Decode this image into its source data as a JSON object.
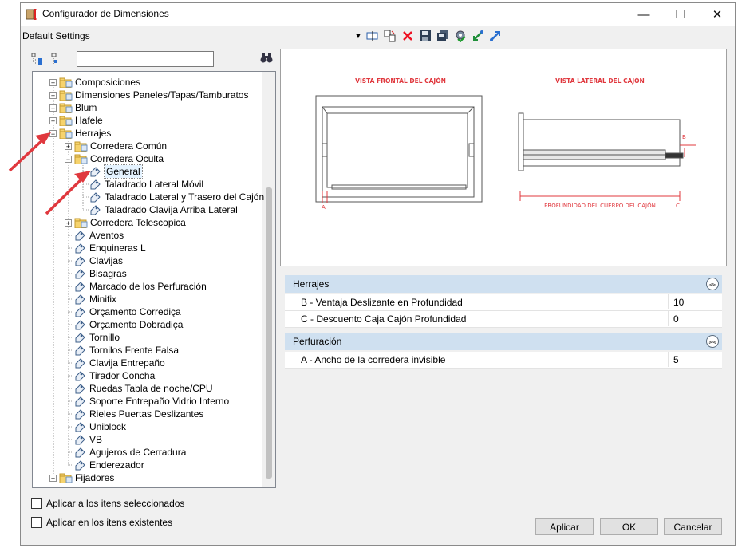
{
  "window": {
    "title": "Configurador de Dimensiones",
    "minimize": "—",
    "maximize": "☐",
    "close": "✕"
  },
  "settings": {
    "label": "Default Settings"
  },
  "tree": {
    "items": [
      {
        "label": "Composiciones"
      },
      {
        "label": "Dimensiones Paneles/Tapas/Tamburatos"
      },
      {
        "label": "Blum"
      },
      {
        "label": "Hafele"
      },
      {
        "label": "Herrajes"
      },
      {
        "label": "Corredera Común"
      },
      {
        "label": "Corredera Oculta"
      },
      {
        "label": "General"
      },
      {
        "label": "Taladrado Lateral Móvil"
      },
      {
        "label": "Taladrado Lateral y Trasero del Cajón"
      },
      {
        "label": "Taladrado Clavija Arriba Lateral"
      },
      {
        "label": "Corredera Telescopica"
      },
      {
        "label": "Aventos"
      },
      {
        "label": "Enquineras L"
      },
      {
        "label": "Clavijas"
      },
      {
        "label": "Bisagras"
      },
      {
        "label": "Marcado de los Perfuración"
      },
      {
        "label": "Minifix"
      },
      {
        "label": "Orçamento Corrediça"
      },
      {
        "label": "Orçamento Dobradiça"
      },
      {
        "label": "Tornillo"
      },
      {
        "label": "Tornilos Frente Falsa"
      },
      {
        "label": "Clavija Entrepaño"
      },
      {
        "label": "Tirador Concha"
      },
      {
        "label": "Ruedas Tabla de noche/CPU"
      },
      {
        "label": "Soporte Entrepaño Vidrio Interno"
      },
      {
        "label": "Rieles Puertas Deslizantes"
      },
      {
        "label": "Uniblock"
      },
      {
        "label": "VB"
      },
      {
        "label": "Agujeros de Cerradura"
      },
      {
        "label": "Enderezador"
      },
      {
        "label": "Fijadores"
      }
    ]
  },
  "preview": {
    "front_title": "VISTA FRONTAL DEL CAJÓN",
    "side_title": "VISTA LATERAL DEL CAJÓN",
    "depth_label": "PROFUNDIDAD DEL CUERPO DEL CAJÓN",
    "label_a": "A",
    "label_b": "B",
    "label_c": "C"
  },
  "properties": {
    "categories": [
      {
        "title": "Herrajes",
        "rows": [
          {
            "name": "B - Ventaja Deslizante en Profundidad",
            "value": "10"
          },
          {
            "name": "C - Descuento Caja Cajón Profundidad",
            "value": "0"
          }
        ]
      },
      {
        "title": "Perfuración",
        "rows": [
          {
            "name": "A - Ancho de la corredera invisible",
            "value": "5"
          }
        ]
      }
    ]
  },
  "options": {
    "apply_selected": "Aplicar a los itens seleccionados",
    "apply_existing": "Aplicar en los itens existentes"
  },
  "buttons": {
    "apply": "Aplicar",
    "ok": "OK",
    "cancel": "Cancelar"
  },
  "colors": {
    "accent_red": "#e0383e",
    "category_bg": "#cfe0f0"
  }
}
